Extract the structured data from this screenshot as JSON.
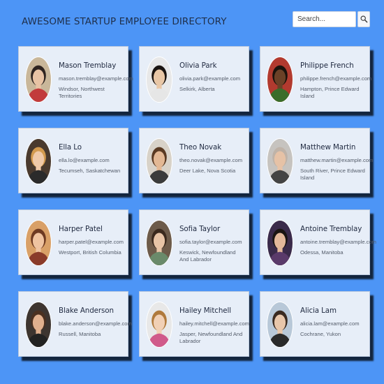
{
  "header": {
    "title": "AWESOME STARTUP EMPLOYEE DIRECTORY",
    "search_placeholder": "Search..."
  },
  "icons": {
    "search_button": "magnifier-icon"
  },
  "employees": [
    {
      "name": "Mason Tremblay",
      "email": "mason.tremblay@example.com",
      "location": "Windsor, Northwest Territories",
      "photo": {
        "bg": "#c9b79a",
        "skin": "#e8c3a4",
        "hair": "#2e2420",
        "shirt": "#c23b3b"
      }
    },
    {
      "name": "Olivia Park",
      "email": "olivia.park@example.com",
      "location": "Selkirk, Alberta",
      "photo": {
        "bg": "#e8e8e8",
        "skin": "#e9c7a6",
        "hair": "#1b1410",
        "shirt": "#e6e6e6"
      }
    },
    {
      "name": "Philippe French",
      "email": "philippe.french@example.com",
      "location": "Hampton, Prince Edward Island",
      "photo": {
        "bg": "#b23a2f",
        "skin": "#6b4127",
        "hair": "#1a120c",
        "shirt": "#3a6d2a"
      }
    },
    {
      "name": "Ella Lo",
      "email": "ella.lo@example.com",
      "location": "Tecumseh, Saskatchewan",
      "photo": {
        "bg": "#4a3a2e",
        "skin": "#f0c9a8",
        "hair": "#d39a4e",
        "shirt": "#2b2b2b"
      }
    },
    {
      "name": "Theo Novak",
      "email": "theo.novak@example.com",
      "location": "Deer Lake, Nova Scotia",
      "photo": {
        "bg": "#d8d2c8",
        "skin": "#e3b894",
        "hair": "#5a3a22",
        "shirt": "#3b3b3b"
      }
    },
    {
      "name": "Matthew Martin",
      "email": "matthew.martin@example.com",
      "location": "South River, Prince Edward Island",
      "photo": {
        "bg": "#c6c3bf",
        "skin": "#e6c2a6",
        "hair": "#bfb3a8",
        "shirt": "#444444"
      }
    },
    {
      "name": "Harper Patel",
      "email": "harper.patel@example.com",
      "location": "Westport, British Columbia",
      "photo": {
        "bg": "#d9a067",
        "skin": "#efc3a0",
        "hair": "#6e3a22",
        "shirt": "#8a3b2a"
      }
    },
    {
      "name": "Sofia Taylor",
      "email": "sofia.taylor@example.com",
      "location": "Keswick, Newfoundland And Labrador",
      "photo": {
        "bg": "#6d5b4a",
        "skin": "#e7c4a6",
        "hair": "#3b2a1e",
        "shirt": "#6a8a6a"
      }
    },
    {
      "name": "Antoine Tremblay",
      "email": "antoine.tremblay@example.com",
      "location": "Odessa, Manitoba",
      "photo": {
        "bg": "#3a2a4a",
        "skin": "#e2b79a",
        "hair": "#1a1412",
        "shirt": "#5a3a6a"
      }
    },
    {
      "name": "Blake Anderson",
      "email": "blake.anderson@example.com",
      "location": "Russell, Manitoba",
      "photo": {
        "bg": "#3d3530",
        "skin": "#e0b08e",
        "hair": "#4a3020",
        "shirt": "#222222"
      }
    },
    {
      "name": "Hailey Mitchell",
      "email": "hailey.mitchell@example.com",
      "location": "Jasper, Newfoundland And Labrador",
      "photo": {
        "bg": "#e8e8e8",
        "skin": "#f1d0b5",
        "hair": "#b07a3c",
        "shirt": "#d05a8a"
      }
    },
    {
      "name": "Alicia Lam",
      "email": "alicia.lam@example.com",
      "location": "Cochrane, Yukon",
      "photo": {
        "bg": "#b8c8d8",
        "skin": "#e8c6aa",
        "hair": "#3a2a20",
        "shirt": "#2a2a2a"
      }
    }
  ]
}
